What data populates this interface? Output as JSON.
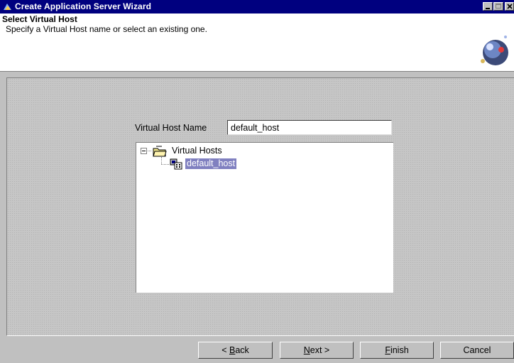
{
  "window": {
    "title": "Create Application Server Wizard",
    "title_bar_color": "#00007f"
  },
  "header": {
    "heading": "Select Virtual Host",
    "description": "Specify a Virtual Host name or select an existing one."
  },
  "form": {
    "virtual_host_label": "Virtual Host Name",
    "virtual_host_value": "default_host"
  },
  "tree": {
    "root": {
      "label": "Virtual Hosts",
      "icon": "folder-icon",
      "expanded": true
    },
    "children": [
      {
        "label": "default_host",
        "icon": "virtual-host-icon",
        "selected": true
      }
    ],
    "selection_color": "#8080c0"
  },
  "buttons": {
    "back": {
      "mnemonic": "B",
      "prefix": "< ",
      "suffix": "ack"
    },
    "next": {
      "mnemonic": "N",
      "suffix": "ext >"
    },
    "finish": {
      "mnemonic": "F",
      "suffix": "inish"
    },
    "cancel": {
      "label": "Cancel"
    }
  }
}
